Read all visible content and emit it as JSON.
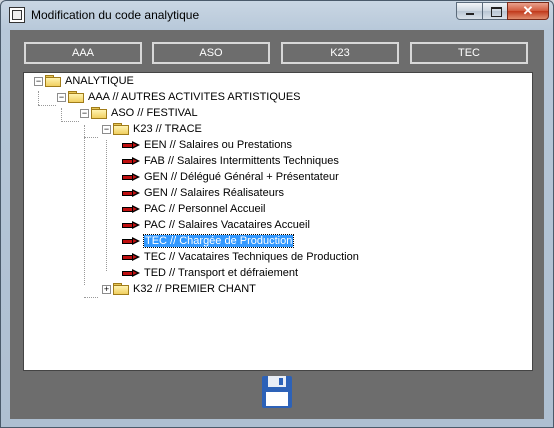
{
  "window": {
    "title": "Modification du code analytique",
    "close_glyph": "✕",
    "icons": {
      "app": "app-icon",
      "save": "floppy-disk-icon"
    }
  },
  "tabs": [
    "AAA",
    "ASO",
    "K23",
    "TEC"
  ],
  "tree": {
    "root": "ANALYTIQUE",
    "aaa": "AAA // AUTRES ACTIVITES ARTISTIQUES",
    "aso": "ASO // FESTIVAL",
    "k23": "K23 // TRACE",
    "items": [
      "EEN // Salaires ou Prestations",
      "FAB // Salaires Intermittents Techniques",
      "GEN // Délégué Général + Présentateur",
      "GEN // Salaires Réalisateurs",
      "PAC // Personnel Accueil",
      "PAC // Salaires Vacataires Accueil",
      "TEC // Chargée de Production",
      "TEC // Vacataires Techniques de Production",
      "TED // Transport et défraiement"
    ],
    "selected_index": 6,
    "k32": "K32 // PREMIER CHANT"
  },
  "expander_glyphs": {
    "expanded": "−",
    "collapsed": "+"
  }
}
